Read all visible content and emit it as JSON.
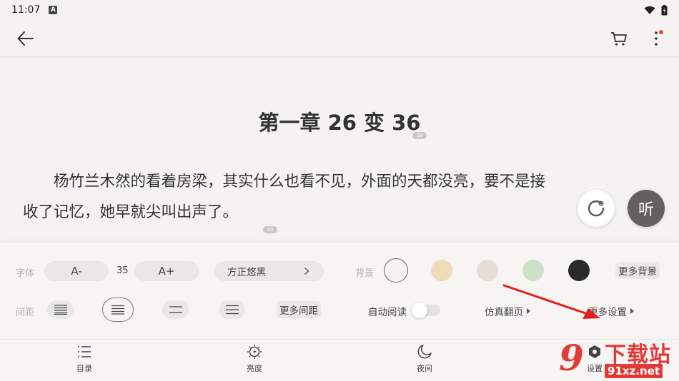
{
  "status_bar": {
    "time": "11:07",
    "notification_letter": "A"
  },
  "reader": {
    "chapter_title": "第一章 26 变 36",
    "title_comment_count": "36",
    "paragraph_line1": "杨竹兰木然的看着房梁，其实什么也看不见，外面的天都没亮，要不是接",
    "paragraph_line2": "收了记忆，她早就尖叫出声了。",
    "paragraph_comment_count": "10",
    "listen_label": "听"
  },
  "settings": {
    "font_label": "字体",
    "font_decrease": "A-",
    "font_size": "35",
    "font_increase": "A+",
    "font_family": "方正悠黑",
    "background_label": "背景",
    "more_backgrounds": "更多背景",
    "background_colors": [
      "#f4f3f1",
      "#eedcb8",
      "#e6dfd6",
      "#cfe0c8",
      "#2b2a2a"
    ],
    "spacing_label": "间距",
    "more_spacing": "更多间距",
    "auto_read_label": "自动阅读",
    "auto_read_on": false,
    "page_turn_mode": "仿真翻页",
    "more_settings": "更多设置"
  },
  "bottom_nav": {
    "toc": "目录",
    "brightness": "亮度",
    "night": "夜间",
    "settings": "设置"
  },
  "watermark": {
    "cn": "下载站",
    "url": "91xz.net",
    "mark": "9"
  },
  "colors": {
    "accent_red": "#e23a36",
    "arrow_red": "#e02020"
  }
}
